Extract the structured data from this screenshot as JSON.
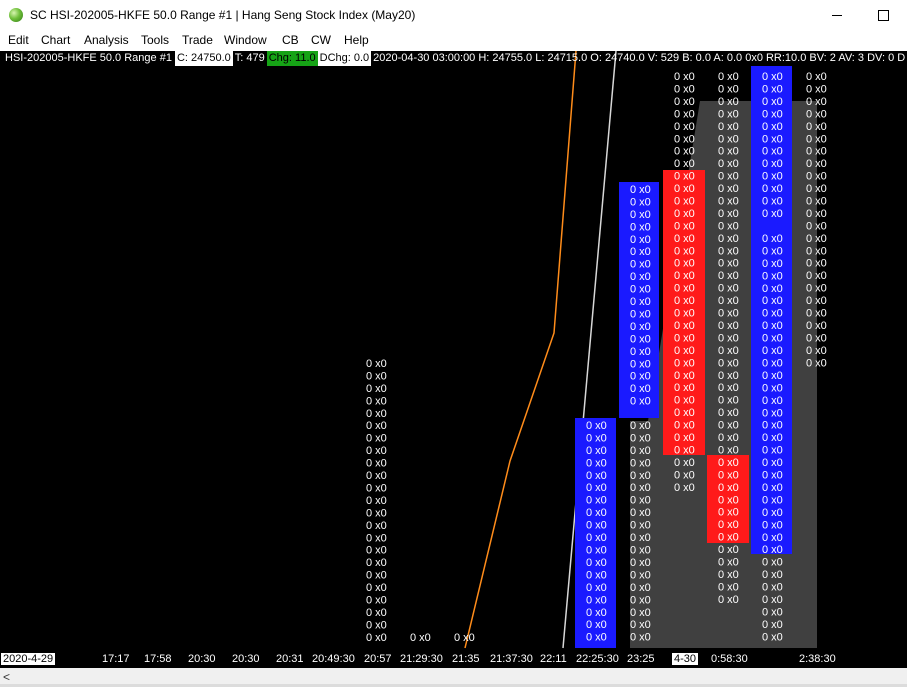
{
  "window": {
    "title": "SC HSI-202005-HKFE  50.0 Range  #1 | Hang Seng Stock Index (May20)",
    "minimize_glyph": "minimize-icon",
    "maximize_glyph": "maximize-icon"
  },
  "menu": [
    "Edit",
    "Chart",
    "Analysis",
    "Tools",
    "Trade",
    "Window",
    "CB",
    "CW",
    "Help"
  ],
  "info_bar": {
    "symbol": "HSI-202005-HKFE  50.0 Range  #1",
    "close": "C: 24750.0",
    "trades": "T: 479",
    "change": "Chg: 11.0",
    "dchange": "DChg: 0.0",
    "rest": "2020-04-30 03:00:00 H: 24755.0 L: 24715.0 O: 24740.0 V: 529 B: 0.0 A: 0.0 0x0 RR:10.0 BV: 2 AV: 3 DV: 0 D"
  },
  "cell_text": "0 x0",
  "colors": {
    "background": "#000000",
    "up_bar": "#1a1aff",
    "down_bar": "#ff1a1a",
    "shadow": "#404040",
    "orange_line": "#ff8c1a",
    "white_line": "#d8d8d8",
    "chg_bg": "#16a316"
  },
  "time_axis": [
    "2020-4-29",
    "17:17",
    "17:58",
    "20:30",
    "20:30",
    "20:31",
    "20:49:30",
    "20:57",
    "21:29:30",
    "21:35",
    "21:37:30",
    "22:11",
    "22:25:30",
    "23:25",
    "4-30",
    "0:58:30",
    "2:38:30"
  ],
  "scroll": {
    "left_arrow": "<"
  }
}
